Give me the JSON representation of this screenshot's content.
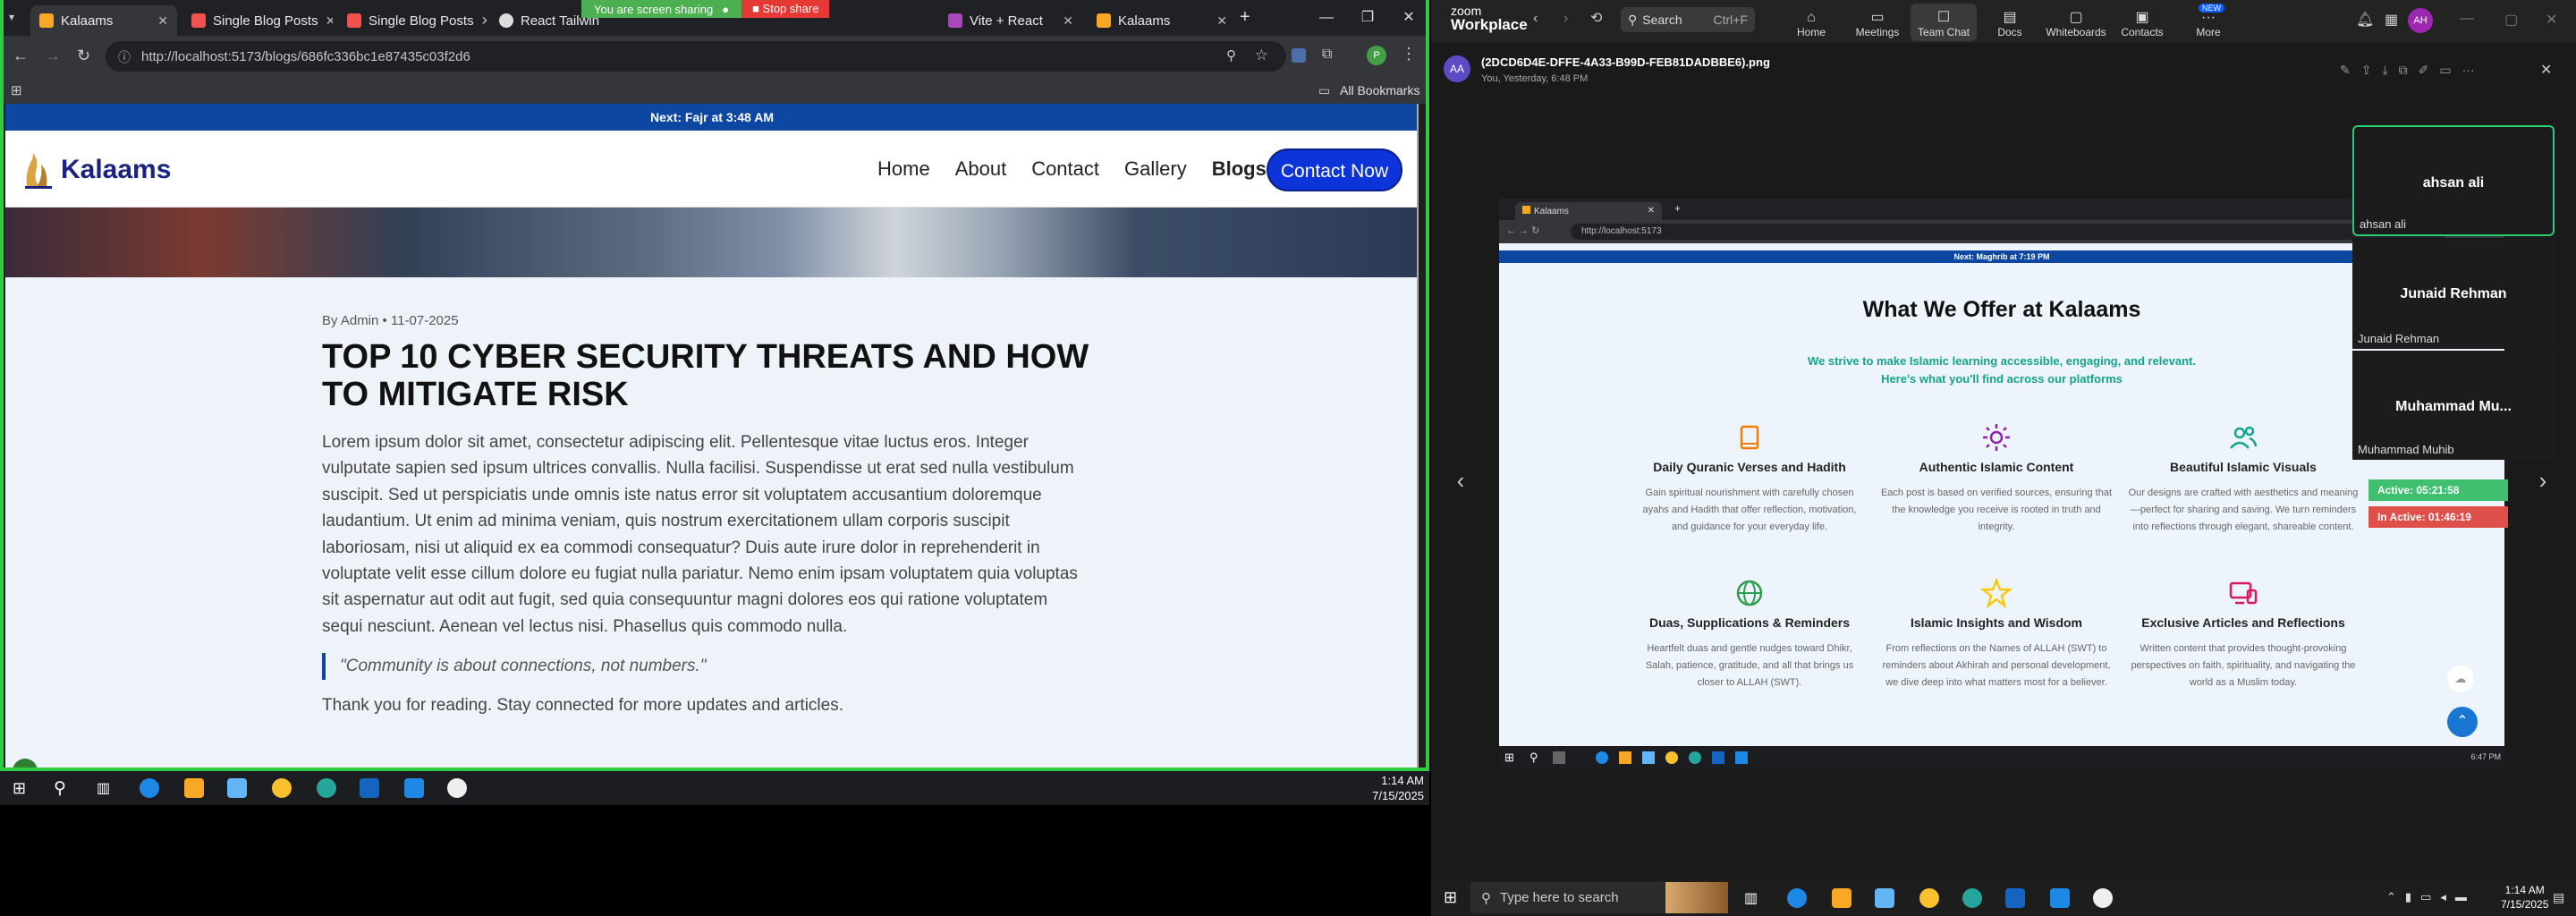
{
  "left_browser": {
    "tabs": [
      {
        "label": "Kalaams",
        "color": "#f9a825",
        "active": true
      },
      {
        "label": "Single Blog Posts",
        "color": "#ef5350"
      },
      {
        "label": "Single Blog Posts",
        "color": "#ef5350"
      },
      {
        "label": "React Tailwind",
        "color": "#dddddd"
      },
      {
        "label": "Vite + React",
        "color": "#ab47bc"
      },
      {
        "label": "Kalaams",
        "color": "#f9a825"
      }
    ],
    "screen_sharing_text": "You are screen sharing",
    "stop_share_label": "Stop share",
    "url": "http://localhost:5173/blogs/686fc336bc1e87435c03f2d6",
    "bookmarks_label": "All Bookmarks",
    "profile_initial": "P"
  },
  "site": {
    "prayer_strip": "Next: Fajr at 3:48 AM",
    "logo": "Kalaams",
    "nav": [
      "Home",
      "About",
      "Contact",
      "Gallery",
      "Blogs"
    ],
    "cta": "Contact Now",
    "meta": "By Admin • 11-07-2025",
    "title": "Top 10 Cyber Security Threats and How to Mitigate Risk",
    "body": "Lorem ipsum dolor sit amet, consectetur adipiscing elit. Pellentesque vitae luctus eros. Integer vulputate sapien sed ipsum ultrices convallis. Nulla facilisi. Suspendisse ut erat sed nulla vestibulum suscipit. Sed ut perspiciatis unde omnis iste natus error sit voluptatem accusantium doloremque laudantium. Ut enim ad minima veniam, quis nostrum exercitationem ullam corporis suscipit laboriosam, nisi ut aliquid ex ea commodi consequatur? Duis aute irure dolor in reprehenderit in voluptate velit esse cillum dolore eu fugiat nulla pariatur. Nemo enim ipsam voluptatem quia voluptas sit aspernatur aut odit aut fugit, sed quia consequuntur magni dolores eos qui ratione voluptatem sequi nesciunt. Aenean vel lectus nisi. Phasellus quis commodo nulla.",
    "quote": "\"Community is about connections, not numbers.\"",
    "thanks": "Thank you for reading. Stay connected for more updates and articles."
  },
  "left_taskbar": {
    "time": "1:14 AM",
    "date": "7/15/2025"
  },
  "zoom": {
    "brand_top": "zoom",
    "brand_bottom": "Workplace",
    "search": "Search",
    "shortcut": "Ctrl+F",
    "nav": [
      "Home",
      "Meetings",
      "Team Chat",
      "Docs",
      "Whiteboards",
      "Contacts",
      "More"
    ],
    "new_badge": "NEW",
    "avatar": "AA",
    "user_initials": "AH",
    "file_name": "(2DCD6D4E-DFFE-4A33-B99D-FEB81DADBBE6).png",
    "file_sub": "You, Yesterday, 6:48 PM"
  },
  "shared_screen": {
    "tab_label": "Kalaams",
    "url": "http://localhost:5173",
    "prayer_strip": "Next: Maghrib at 7:19 PM",
    "heading": "What We Offer at Kalaams",
    "subheading_1": "We strive to make Islamic learning accessible, engaging, and relevant.",
    "subheading_2": "Here's what you'll find across our platforms",
    "cards": [
      {
        "title": "Daily Quranic Verses and Hadith",
        "desc": "Gain spiritual nourishment with carefully chosen ayahs and Hadith that offer reflection, motivation, and guidance for your everyday life.",
        "color": "#f57c00"
      },
      {
        "title": "Authentic Islamic Content",
        "desc": "Each post is based on verified sources, ensuring that the knowledge you receive is rooted in truth and integrity.",
        "color": "#8e24aa"
      },
      {
        "title": "Beautiful Islamic Visuals",
        "desc": "Our designs are crafted with aesthetics and meaning—perfect for sharing and saving. We turn reminders into reflections through elegant, shareable content.",
        "color": "#14a38b"
      },
      {
        "title": "Duas, Supplications & Reminders",
        "desc": "Heartfelt duas and gentle nudges toward Dhikr, Salah, patience, gratitude, and all that brings us closer to ALLAH (SWT).",
        "color": "#2e9e4f"
      },
      {
        "title": "Islamic Insights and Wisdom",
        "desc": "From reflections on the Names of ALLAH (SWT) to reminders about Akhirah and personal development, we dive deep into what matters most for a believer.",
        "color": "#f9c80e"
      },
      {
        "title": "Exclusive Articles and Reflections",
        "desc": "Written content that provides thought-provoking perspectives on faith, spirituality, and navigating the world as a Muslim today.",
        "color": "#d81b60"
      }
    ],
    "clock": "6:47 PM"
  },
  "participants": [
    {
      "name": "ahsan ali",
      "label": "ahsan ali",
      "active": true
    },
    {
      "name": "Junaid Rehman",
      "label": "Junaid Rehman"
    },
    {
      "name": "Muhammad  Mu...",
      "label": "Muhammad Muhib"
    }
  ],
  "activity": {
    "active": "Active: 05:21:58",
    "inactive": "In Active: 01:46:19"
  },
  "right_taskbar": {
    "search_placeholder": "Type here to search",
    "time": "1:14 AM",
    "date": "7/15/2025"
  }
}
